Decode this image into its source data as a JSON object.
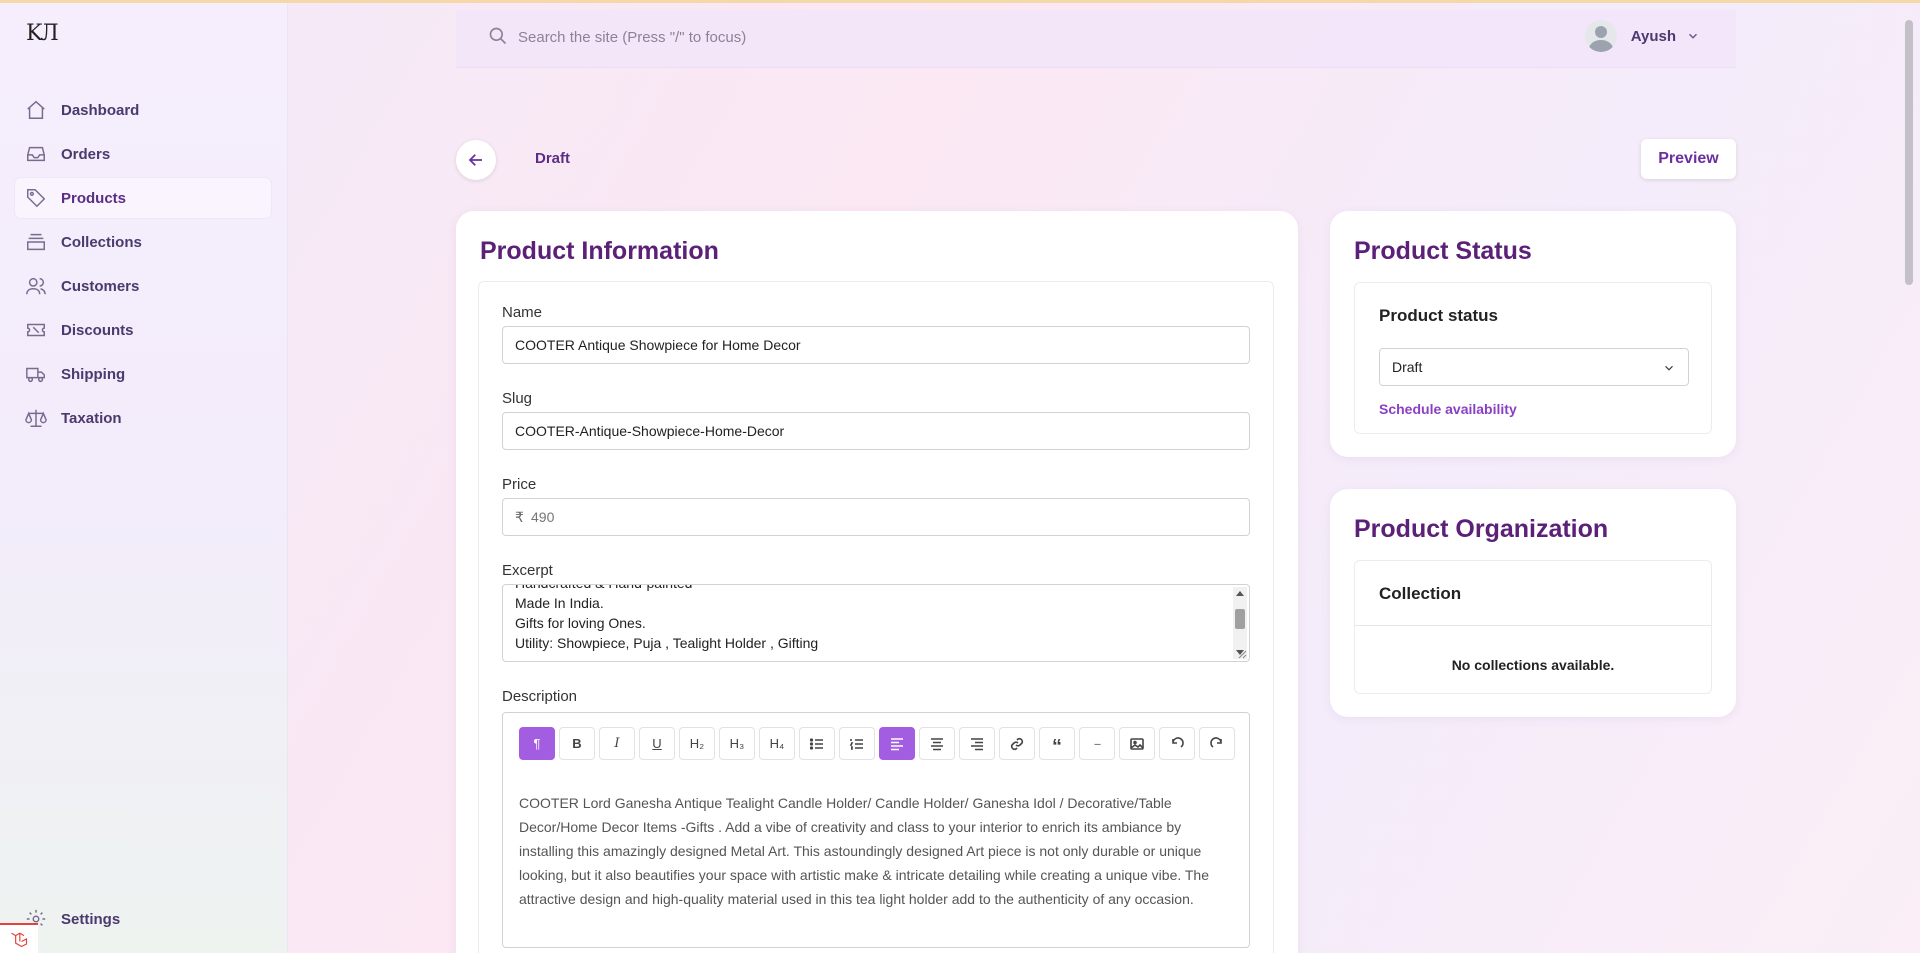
{
  "app": {
    "logo_text": "KЛ"
  },
  "sidebar": {
    "items": [
      {
        "label": "Dashboard",
        "icon": "home-icon"
      },
      {
        "label": "Orders",
        "icon": "inbox-icon"
      },
      {
        "label": "Products",
        "icon": "tag-icon",
        "active": true
      },
      {
        "label": "Collections",
        "icon": "collection-icon"
      },
      {
        "label": "Customers",
        "icon": "users-icon"
      },
      {
        "label": "Discounts",
        "icon": "ticket-icon"
      },
      {
        "label": "Shipping",
        "icon": "truck-icon"
      },
      {
        "label": "Taxation",
        "icon": "scale-icon"
      }
    ],
    "settings_label": "Settings"
  },
  "topbar": {
    "search_placeholder": "Search the site (Press \"/\" to focus)",
    "user_name": "Ayush"
  },
  "header": {
    "status_label": "Draft",
    "preview_label": "Preview"
  },
  "product_info": {
    "title": "Product Information",
    "name_label": "Name",
    "name_value": "COOTER Antique Showpiece for Home Decor",
    "slug_label": "Slug",
    "slug_value": "COOTER-Antique-Showpiece-Home-Decor",
    "price_label": "Price",
    "currency_symbol": "₹",
    "price_placeholder": "490",
    "excerpt_label": "Excerpt",
    "excerpt_lines": [
      "Handcrafted & Hand-painted",
      "Made In India.",
      "Gifts for loving Ones.",
      "Utility: Showpiece, Puja , Tealight Holder , Gifting"
    ],
    "description_label": "Description",
    "description_text": "COOTER Lord Ganesha Antique Tealight Candle Holder/ Candle Holder/ Ganesha Idol / Decorative/Table Decor/Home Decor Items -Gifts . Add a vibe of creativity and class to your interior to enrich its ambiance by installing this amazingly designed Metal Art. This astoundingly designed Art piece is not only durable or unique looking, but it also beautifies your space with artistic make & intricate detailing while creating a unique vibe. The attractive design and high-quality material used in this tea light holder add to the authenticity of any occasion.",
    "toolbar": [
      {
        "name": "paragraph-button",
        "glyph": "¶",
        "active": true
      },
      {
        "name": "bold-button",
        "glyph": "B"
      },
      {
        "name": "italic-button",
        "glyph": "I"
      },
      {
        "name": "underline-button",
        "glyph": "U"
      },
      {
        "name": "h2-button",
        "glyph": "H₂"
      },
      {
        "name": "h3-button",
        "glyph": "H₃"
      },
      {
        "name": "h4-button",
        "glyph": "H₄"
      },
      {
        "name": "bullet-list-button",
        "glyph": "list"
      },
      {
        "name": "ordered-list-button",
        "glyph": "olist"
      },
      {
        "name": "align-left-button",
        "glyph": "alignleft",
        "active": true
      },
      {
        "name": "align-center-button",
        "glyph": "aligncenter"
      },
      {
        "name": "align-right-button",
        "glyph": "alignright"
      },
      {
        "name": "link-button",
        "glyph": "link"
      },
      {
        "name": "quote-button",
        "glyph": "“"
      },
      {
        "name": "horizontal-rule-button",
        "glyph": "---"
      },
      {
        "name": "image-button",
        "glyph": "image"
      },
      {
        "name": "undo-button",
        "glyph": "undo"
      },
      {
        "name": "redo-button",
        "glyph": "redo"
      }
    ]
  },
  "product_status": {
    "title": "Product Status",
    "subtitle": "Product status",
    "selected": "Draft",
    "schedule_label": "Schedule availability"
  },
  "product_org": {
    "title": "Product Organization",
    "collection_label": "Collection",
    "empty_text": "No collections available."
  }
}
